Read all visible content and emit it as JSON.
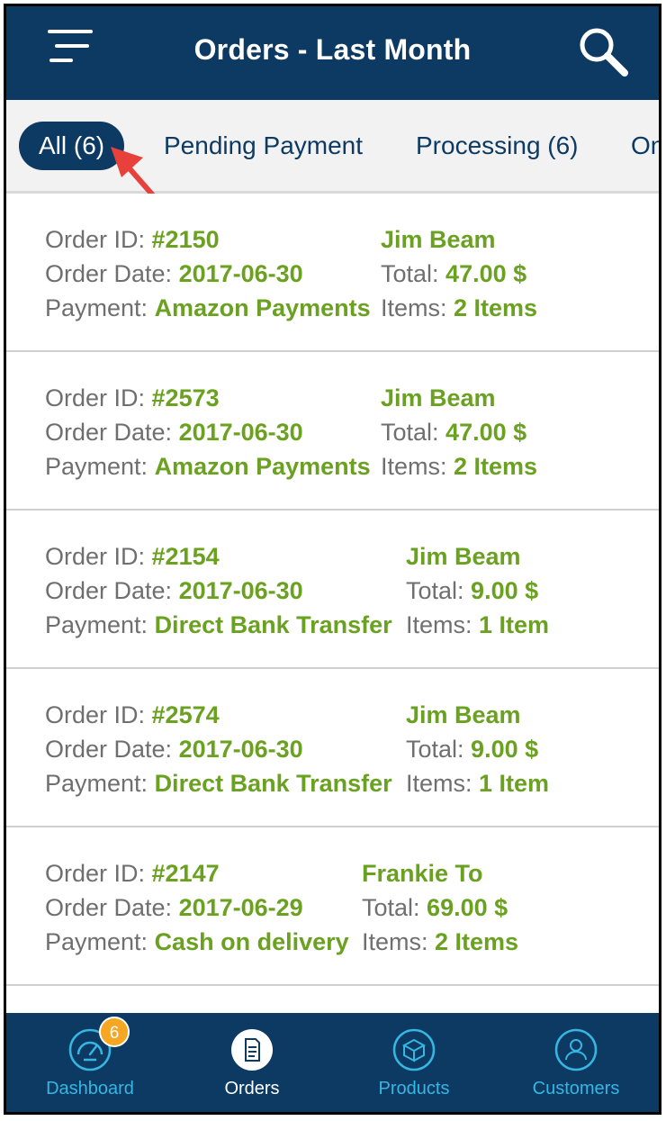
{
  "header": {
    "title": "Orders - Last Month"
  },
  "tabs": [
    {
      "label": "All (6)",
      "active": true
    },
    {
      "label": "Pending Payment"
    },
    {
      "label": "Processing (6)"
    },
    {
      "label": "On"
    }
  ],
  "labels": {
    "order_id": "Order ID: ",
    "order_date": "Order Date: ",
    "payment": "Payment: ",
    "total": "Total: ",
    "items": "Items: "
  },
  "orders": [
    {
      "id": "#2150",
      "date": "2017-06-30",
      "payment": "Amazon Payments",
      "customer": "Jim Beam",
      "total": "47.00 $",
      "items": "2 Items"
    },
    {
      "id": "#2573",
      "date": "2017-06-30",
      "payment": "Amazon Payments",
      "customer": "Jim Beam",
      "total": "47.00 $",
      "items": "2 Items"
    },
    {
      "id": "#2154",
      "date": "2017-06-30",
      "payment": "Direct Bank Transfer",
      "customer": "Jim Beam",
      "total": "9.00 $",
      "items": "1 Item"
    },
    {
      "id": "#2574",
      "date": "2017-06-30",
      "payment": "Direct Bank Transfer",
      "customer": "Jim Beam",
      "total": "9.00 $",
      "items": "1 Item"
    },
    {
      "id": "#2147",
      "date": "2017-06-29",
      "payment": "Cash on delivery",
      "customer": "Frankie To",
      "total": "69.00 $",
      "items": "2 Items"
    }
  ],
  "bottom_nav": {
    "dashboard": {
      "label": "Dashboard",
      "badge": "6"
    },
    "orders": {
      "label": "Orders"
    },
    "products": {
      "label": "Products"
    },
    "customers": {
      "label": "Customers"
    }
  },
  "colors": {
    "header_bg": "#0d3a63",
    "accent_green": "#6aa121",
    "nav_label": "#35b6e3",
    "badge": "#f5a623",
    "arrow": "#e8413b"
  },
  "icons": {
    "menu": "menu-icon",
    "search": "search-icon",
    "dashboard": "speedometer-icon",
    "orders": "document-icon",
    "products": "box-icon",
    "customers": "user-icon"
  }
}
